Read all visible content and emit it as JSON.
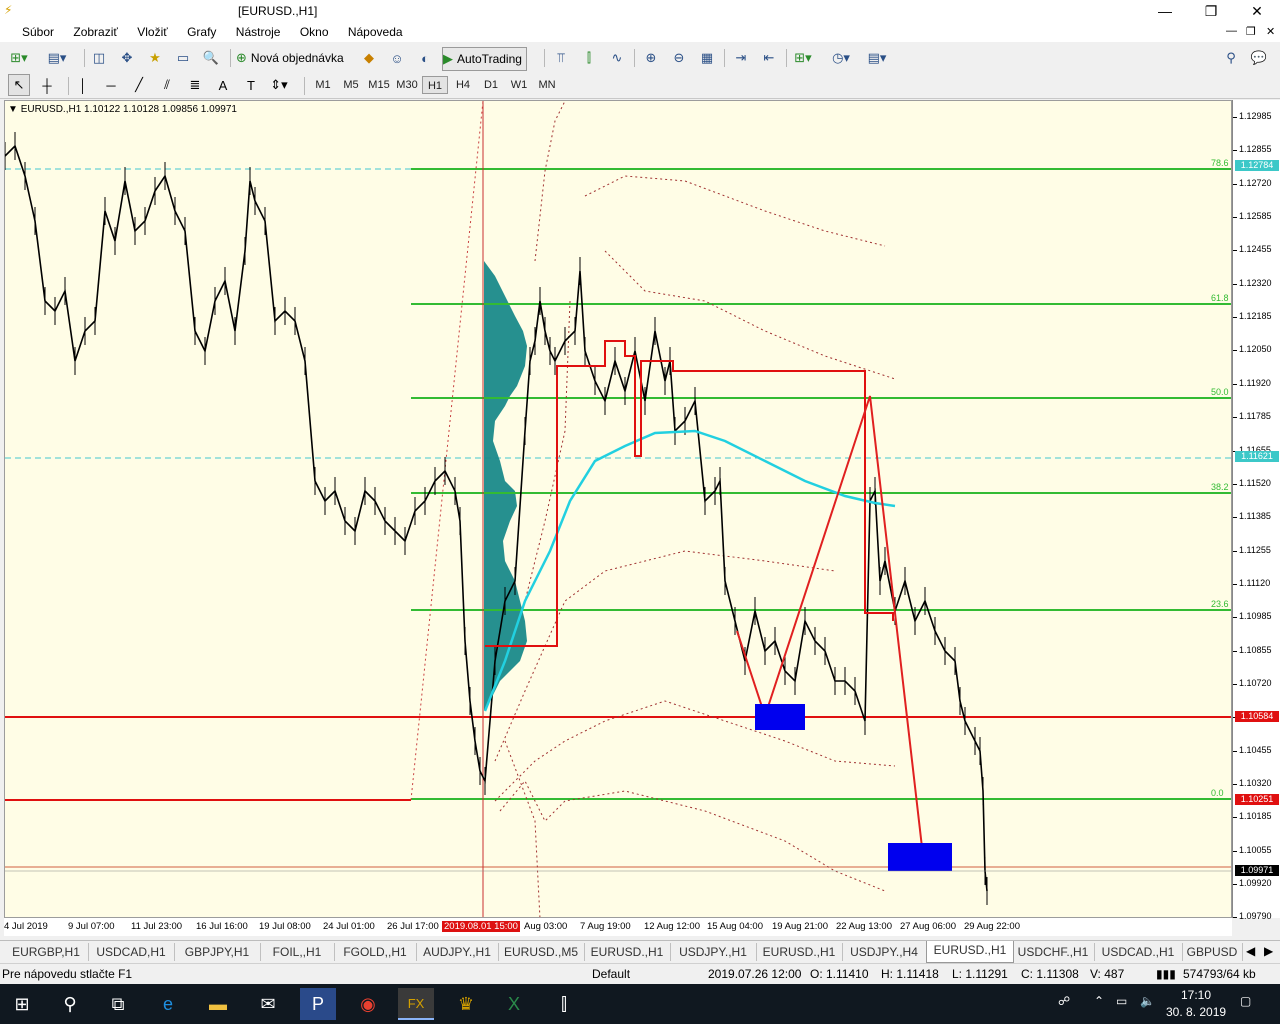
{
  "window": {
    "title": "[EURUSD.,H1]",
    "controls": {
      "minimize": "—",
      "restore": "❐",
      "close": "✕"
    }
  },
  "menu": [
    "Súbor",
    "Zobraziť",
    "Vložiť",
    "Grafy",
    "Nástroje",
    "Okno",
    "Nápoveda"
  ],
  "toolbar": {
    "new_order": "Nová objednávka",
    "autotrading": "AutoTrading"
  },
  "timeframes": [
    "M1",
    "M5",
    "M15",
    "M30",
    "H1",
    "H4",
    "D1",
    "W1",
    "MN"
  ],
  "active_timeframe": "H1",
  "chart": {
    "header": "EURUSD.,H1  1.10122 1.10128 1.09856 1.09971",
    "price_ticks": [
      "1.12985",
      "1.12855",
      "1.12720",
      "1.12585",
      "1.12455",
      "1.12320",
      "1.12185",
      "1.12050",
      "1.11920",
      "1.11785",
      "1.11655",
      "1.11520",
      "1.11385",
      "1.11255",
      "1.11120",
      "1.10985",
      "1.10855",
      "1.10720",
      "1.10585",
      "1.10455",
      "1.10320",
      "1.10185",
      "1.10055",
      "1.09920",
      "1.09790"
    ],
    "price_flags": [
      {
        "value": "1.12784",
        "color": "#3cc8c8"
      },
      {
        "value": "1.11621",
        "color": "#3cc8c8"
      },
      {
        "value": "1.10584",
        "color": "#e01010"
      },
      {
        "value": "1.10251",
        "color": "#e01010"
      },
      {
        "value": "1.09971",
        "color": "#000000"
      }
    ],
    "time_ticks": [
      "4 Jul 2019",
      "9 Jul 07:00",
      "11 Jul 23:00",
      "16 Jul 16:00",
      "19 Jul 08:00",
      "24 Jul 01:00",
      "26 Jul 17:00",
      "2019.08.01 15:00",
      "Aug 03:00",
      "7 Aug 19:00",
      "12 Aug 12:00",
      "15 Aug 04:00",
      "19 Aug 21:00",
      "22 Aug 13:00",
      "27 Aug 06:00",
      "29 Aug 22:00"
    ],
    "highlighted_time": "2019.08.01 15:00",
    "fibo_levels": [
      "78.6",
      "61.8",
      "50.0",
      "38.2",
      "23.6",
      "0.0"
    ],
    "colors": {
      "background": "#fffde6",
      "candles": "#000000",
      "fibo": "#33bb33",
      "profile": "#1a8a8a",
      "vwap": "#22d0e0",
      "support": "#e01010",
      "zone": "#0000ee"
    }
  },
  "tabs": [
    "EURGBP,H1",
    "USDCAD,H1",
    "GBPJPY,H1",
    "FOIL,,H1",
    "FGOLD,,H1",
    "AUDJPY.,H1",
    "EURUSD.,M5",
    "EURUSD.,H1",
    "USDJPY.,H1",
    "EURUSD.,H1",
    "USDJPY.,H4",
    "EURUSD.,H1",
    "USDCHF.,H1",
    "USDCAD.,H1",
    "GBPUSD"
  ],
  "active_tab_index": 11,
  "status": {
    "help": "Pre nápovedu stlačte F1",
    "profile": "Default",
    "datetime": "2019.07.26 12:00",
    "open": "O: 1.11410",
    "high": "H: 1.11418",
    "low": "L: 1.11291",
    "close": "C: 1.11308",
    "volume": "V: 487",
    "traffic": "574793/64 kb"
  },
  "taskbar": {
    "time": "17:10",
    "date": "30. 8. 2019"
  }
}
